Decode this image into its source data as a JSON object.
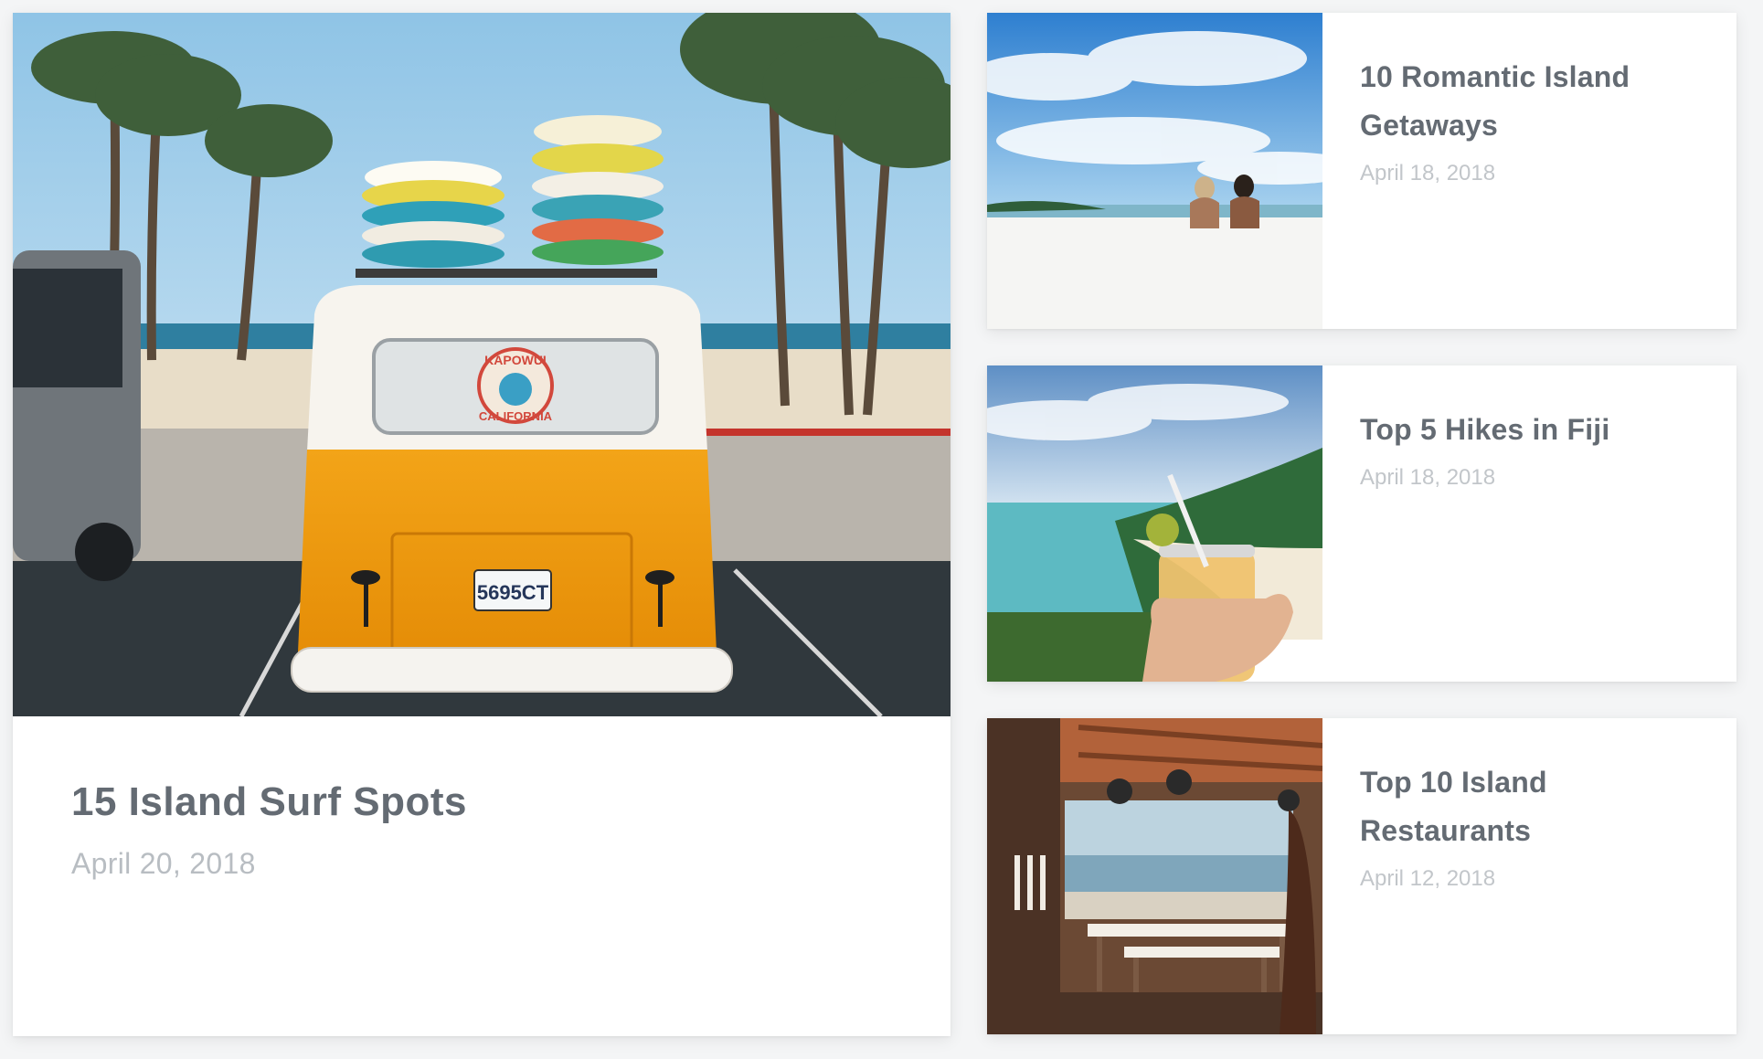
{
  "posts": {
    "featured": {
      "title": "15 Island Surf Spots",
      "date": "April 20, 2018"
    },
    "side": [
      {
        "title": "10 Romantic Island Getaways",
        "date": "April 18, 2018"
      },
      {
        "title": "Top 5 Hikes in Fiji",
        "date": "April 18, 2018"
      },
      {
        "title": "Top 10 Island Restaurants",
        "date": "April 12, 2018"
      }
    ]
  },
  "photo_text": {
    "bus_sticker_top": "KAPOWUI",
    "bus_sticker_bottom": "CALIFORNIA",
    "license_plate": "5695CT"
  },
  "colors": {
    "title": "#646b73",
    "date": "#b8bdc2",
    "background": "#f4f5f6",
    "card": "#ffffff"
  }
}
